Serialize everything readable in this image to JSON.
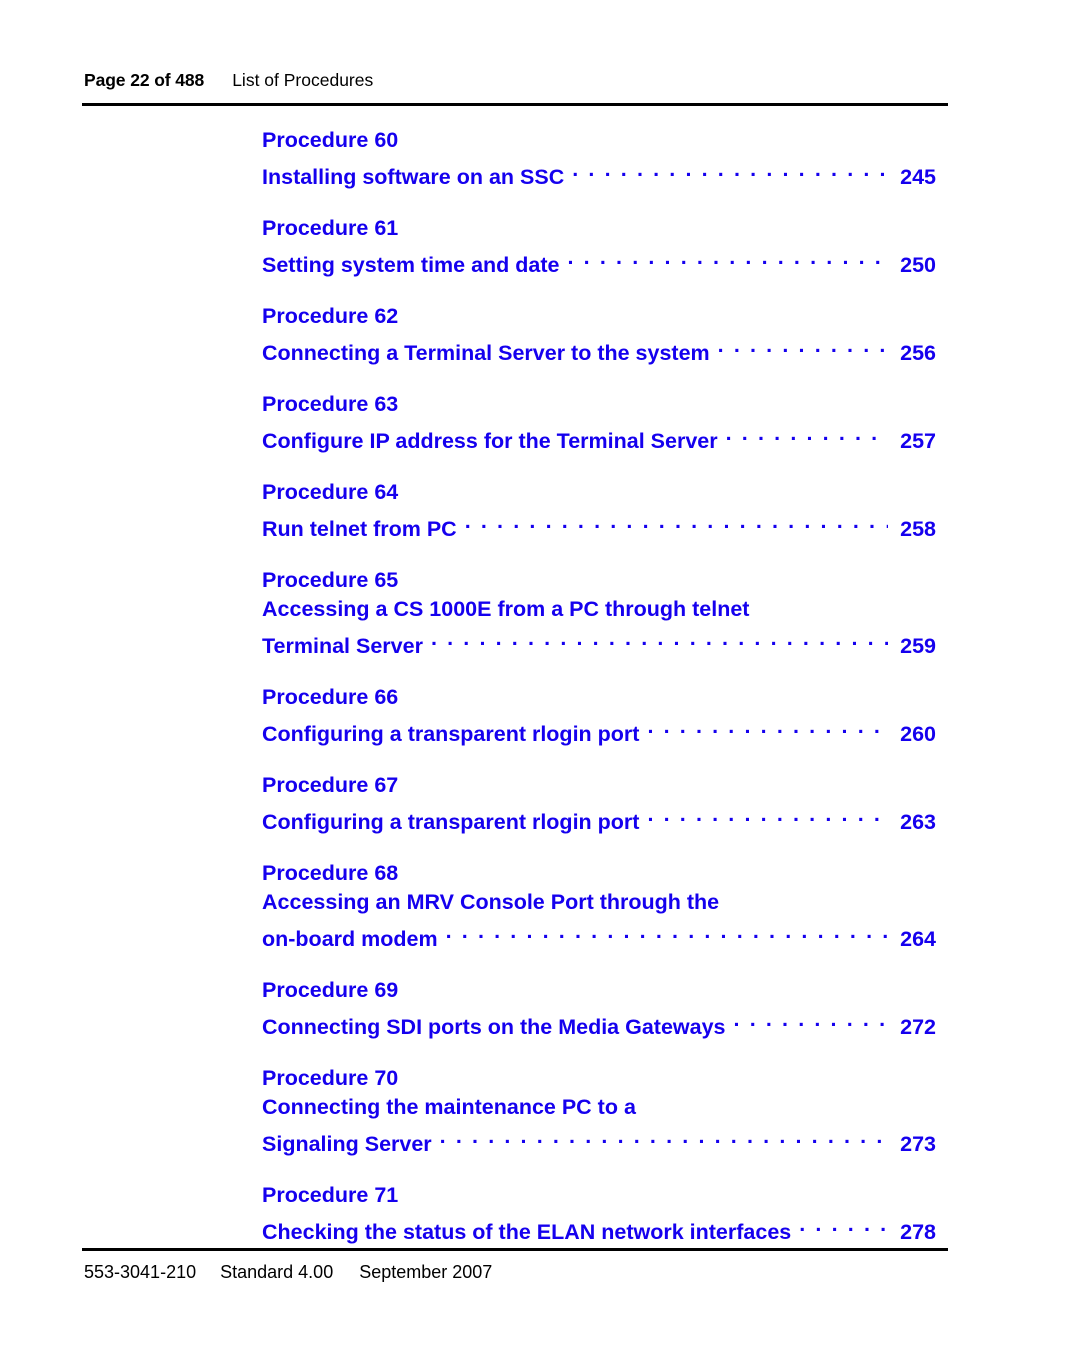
{
  "header": {
    "page_reference": "Page 22 of 488",
    "section_title": "List of Procedures"
  },
  "colors": {
    "entry_blue": "#1500ee",
    "rule_black": "#000000",
    "page_background": "#ffffff"
  },
  "toc": {
    "entries": [
      {
        "label": "Procedure 60",
        "title_lines": [
          "Installing software on an SSC"
        ],
        "page": "245"
      },
      {
        "label": "Procedure 61",
        "title_lines": [
          "Setting system time and date"
        ],
        "page": "250"
      },
      {
        "label": "Procedure 62",
        "title_lines": [
          "Connecting a Terminal Server to the system"
        ],
        "page": "256"
      },
      {
        "label": "Procedure 63",
        "title_lines": [
          "Configure IP address for the Terminal Server"
        ],
        "page": "257"
      },
      {
        "label": "Procedure 64",
        "title_lines": [
          "Run telnet from PC"
        ],
        "page": "258"
      },
      {
        "label": "Procedure 65",
        "title_lines": [
          "Accessing a CS 1000E from a PC through telnet",
          "Terminal Server"
        ],
        "page": "259"
      },
      {
        "label": "Procedure 66",
        "title_lines": [
          "Configuring a transparent rlogin port"
        ],
        "page": "260"
      },
      {
        "label": "Procedure 67",
        "title_lines": [
          "Configuring a transparent rlogin port"
        ],
        "page": "263"
      },
      {
        "label": "Procedure 68",
        "title_lines": [
          "Accessing an MRV Console Port through the",
          "on-board modem"
        ],
        "page": "264"
      },
      {
        "label": "Procedure 69",
        "title_lines": [
          "Connecting SDI ports on the Media Gateways"
        ],
        "page": "272"
      },
      {
        "label": "Procedure 70",
        "title_lines": [
          "Connecting the maintenance PC to a",
          "Signaling Server"
        ],
        "page": "273"
      },
      {
        "label": "Procedure 71",
        "title_lines": [
          "Checking the status of the ELAN network interfaces"
        ],
        "page": "278"
      }
    ]
  },
  "footer": {
    "document_number": "553-3041-210",
    "standard": "Standard 4.00",
    "date": "September 2007"
  }
}
